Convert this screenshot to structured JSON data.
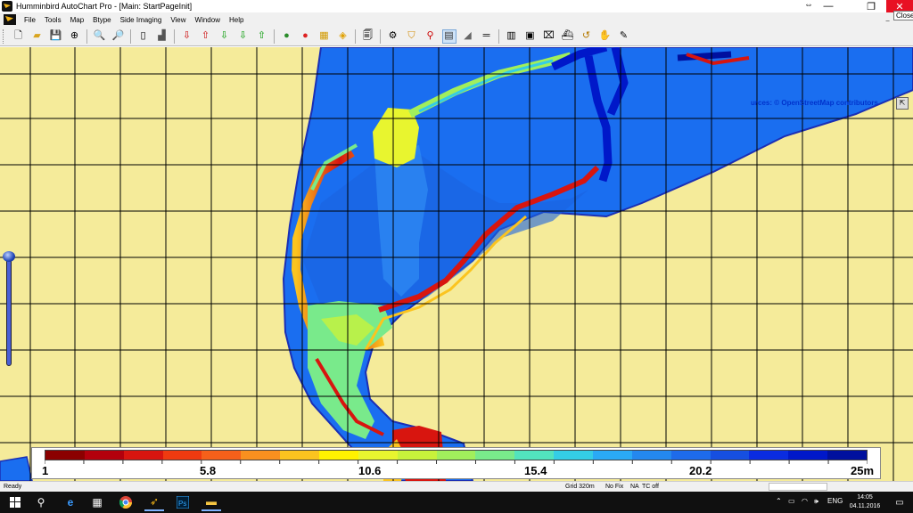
{
  "window": {
    "title": "Humminbird AutoChart Pro - [Main: StartPageInit]",
    "minimize_glyph": "—",
    "restore_glyph": "❐",
    "close_glyph": "✕",
    "close_tooltip": "Close",
    "resize_glyph": "⇔"
  },
  "menu": {
    "items": [
      "File",
      "Tools",
      "Map",
      "Btype",
      "Side Imaging",
      "View",
      "Window",
      "Help"
    ],
    "mdi_controls": "_ ▫ ×"
  },
  "toolbar": {
    "icons": [
      "new-icon",
      "open-icon",
      "save-icon",
      "target-icon",
      "zoom-in-icon",
      "zoom-out-icon",
      "page-icon",
      "chart-icon",
      "import-1-icon",
      "import-2-icon",
      "import-3-icon",
      "export-1-icon",
      "export-2-icon",
      "globe-1-icon",
      "globe-2-icon",
      "tiles-icon",
      "cube-icon",
      "document-icon",
      "gear-icon",
      "marker-icon",
      "pin-icon",
      "layers-icon",
      "wedge-icon",
      "ruler-icon",
      "grid-icon",
      "depth-icon",
      "camera-icon",
      "boat-icon",
      "route-icon",
      "hand-icon",
      "pencil-icon"
    ],
    "selected": "layers-icon"
  },
  "map": {
    "attribution": "urces: © OpenStreetMap contributors",
    "corner_button": "⇱",
    "colors": {
      "land": "#f5eb9a",
      "water": "#1a6ef0",
      "shoreline": "#1a2fb5",
      "grid": "#000000"
    }
  },
  "legend": {
    "labels": [
      "1",
      "5.8",
      "10.6",
      "15.4",
      "20.2",
      "25m"
    ],
    "colors": [
      "#8b0000",
      "#b3000c",
      "#d8150f",
      "#ef3a10",
      "#f5601a",
      "#f9901f",
      "#fbc41f",
      "#fff200",
      "#e8f52f",
      "#c8f23b",
      "#a1ef5c",
      "#79ea8b",
      "#52e3be",
      "#34cde6",
      "#2aaaf5",
      "#2488ee",
      "#1e6bea",
      "#164fe0",
      "#0a2ce0",
      "#0018c9",
      "#00109e"
    ]
  },
  "status": {
    "ready": "Ready",
    "grid": "Grid 320m",
    "fix": "No Fix",
    "na": "NA",
    "tc": "TC off"
  },
  "taskbar": {
    "apps": [
      "windows-icon",
      "search-icon",
      "edge-icon",
      "calculator-icon",
      "chrome-icon",
      "autochart-icon",
      "photoshop-icon",
      "file-explorer-icon"
    ],
    "tray_icons": [
      "up-arrow-icon",
      "battery-icon",
      "network-icon",
      "volume-icon"
    ],
    "language": "ENG",
    "time": "14:05",
    "date": "04.11.2016"
  }
}
